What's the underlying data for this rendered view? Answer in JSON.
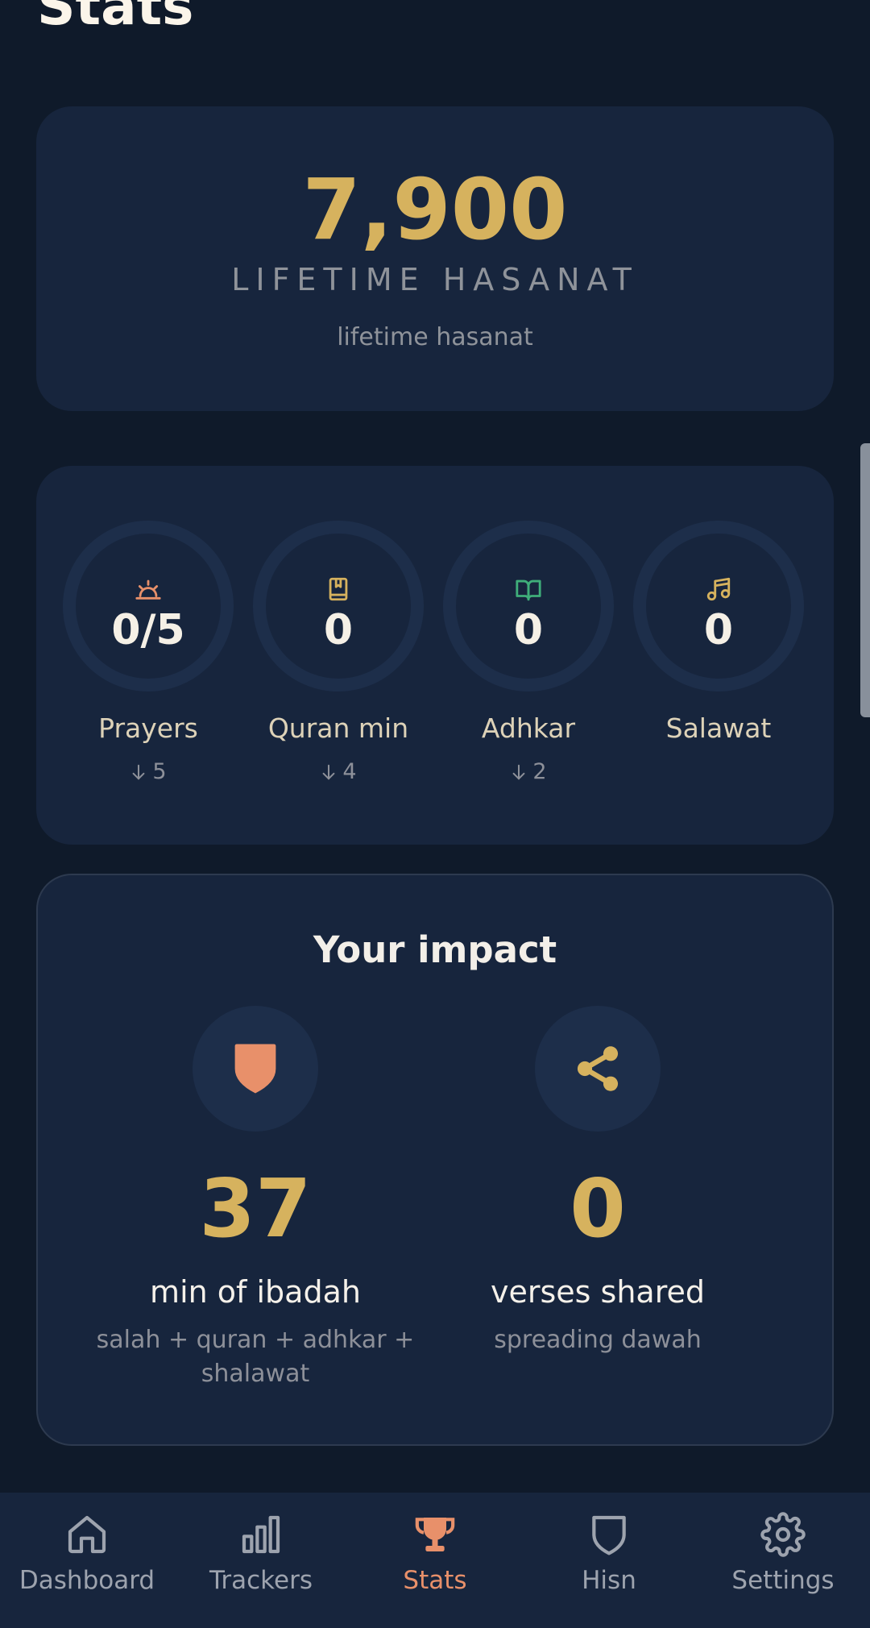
{
  "page": {
    "title": "Stats"
  },
  "hasanat": {
    "value": "7,900",
    "label": "LIFETIME HASANAT",
    "sublabel": "lifetime hasanat"
  },
  "trackers": [
    {
      "icon": "sunrise-icon",
      "value": "0/5",
      "label": "Prayers",
      "delta": "5",
      "color": "#e8906a"
    },
    {
      "icon": "book-icon",
      "value": "0",
      "label": "Quran min",
      "delta": "4",
      "color": "#d6b25e"
    },
    {
      "icon": "open-book-icon",
      "value": "0",
      "label": "Adhkar",
      "delta": "2",
      "color": "#3fae7a"
    },
    {
      "icon": "music-note-icon",
      "value": "0",
      "label": "Salawat",
      "delta": "",
      "color": "#d6b25e"
    }
  ],
  "impact": {
    "title": "Your impact",
    "items": [
      {
        "icon": "shield-icon",
        "value": "37",
        "label": "min of ibadah",
        "sublabel": "salah + quran + adhkar + shalawat"
      },
      {
        "icon": "share-icon",
        "value": "0",
        "label": "verses shared",
        "sublabel": "spreading dawah"
      }
    ]
  },
  "nav": {
    "items": [
      {
        "icon": "home-icon",
        "label": "Dashboard",
        "active": false
      },
      {
        "icon": "bar-chart-icon",
        "label": "Trackers",
        "active": false
      },
      {
        "icon": "trophy-icon",
        "label": "Stats",
        "active": true
      },
      {
        "icon": "shield-icon",
        "label": "Hisn",
        "active": false
      },
      {
        "icon": "gear-icon",
        "label": "Settings",
        "active": false
      }
    ]
  },
  "colors": {
    "background": "#0f1a2a",
    "card": "#17253d",
    "ring": "#1d2e4a",
    "gold": "#d6b25e",
    "accent": "#e8906a",
    "green": "#3fae7a",
    "muted": "#8f939a"
  }
}
